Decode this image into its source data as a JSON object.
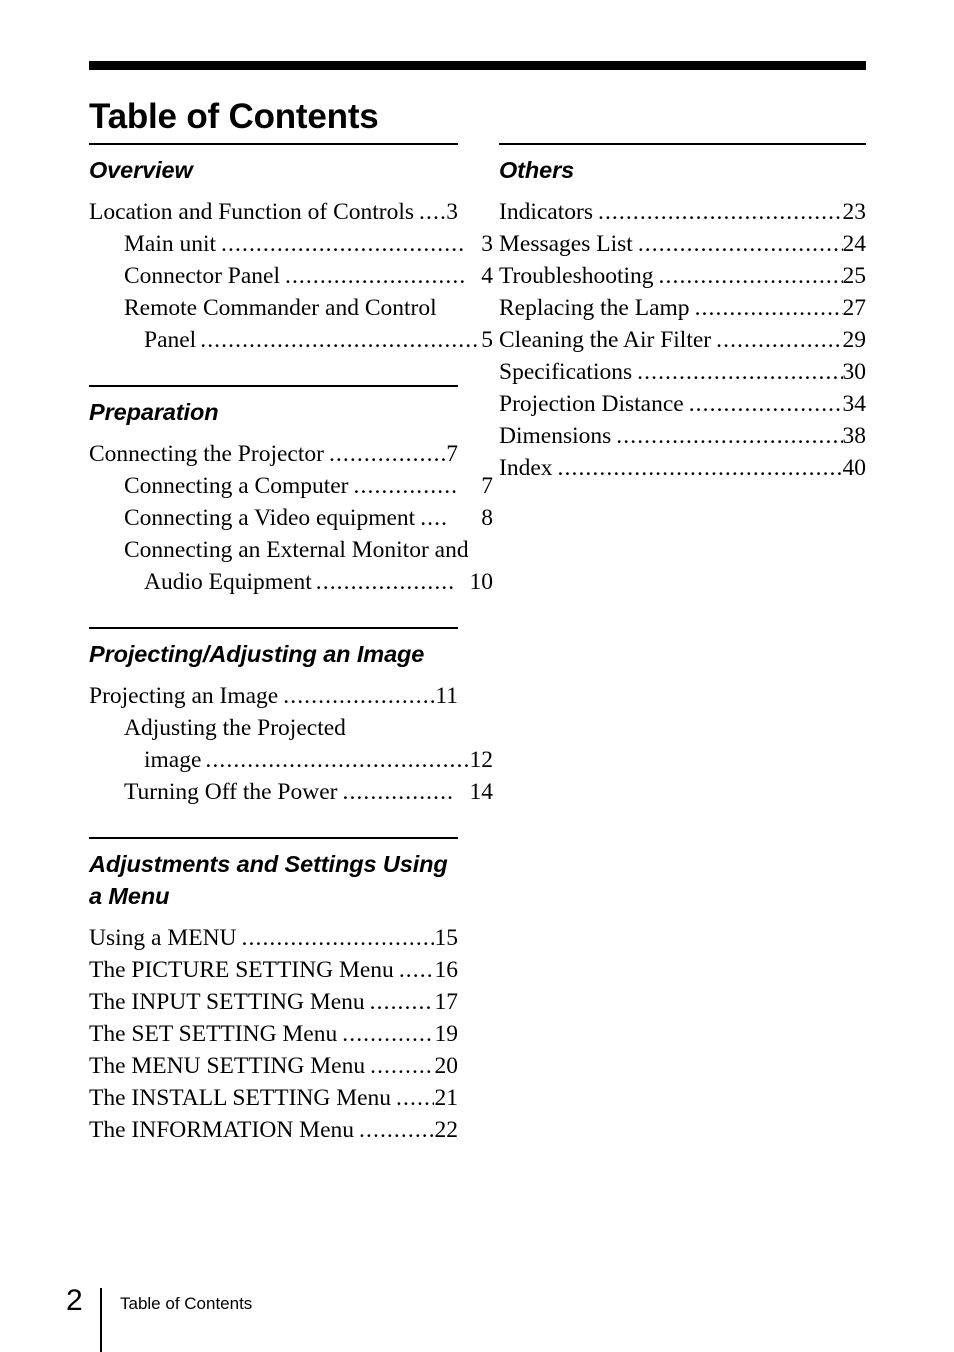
{
  "document": {
    "title": "Table of Contents",
    "page_number": "2",
    "footer_label": "Table of Contents"
  },
  "columns": {
    "left": [
      {
        "heading": "Overview",
        "entries": [
          {
            "level": 1,
            "label": "Location and Function of Controls",
            "page": "3",
            "leader": "...."
          },
          {
            "level": 2,
            "label": "Main unit",
            "page": "3",
            "leader": "..................................."
          },
          {
            "level": 2,
            "label": "Connector Panel",
            "page": "4",
            "leader": ".........................."
          },
          {
            "level": 2,
            "wrapped": true,
            "line1": "Remote Commander and Control",
            "line2": "Panel",
            "page": "5",
            "leader": "........................................."
          }
        ]
      },
      {
        "heading": "Preparation",
        "entries": [
          {
            "level": 1,
            "label": "Connecting the Projector",
            "page": "7",
            "leader": ".................."
          },
          {
            "level": 2,
            "label": "Connecting a Computer",
            "page": "7",
            "leader": "..............."
          },
          {
            "level": 2,
            "label": "Connecting a Video equipment",
            "page": "8",
            "leader": "...."
          },
          {
            "level": 2,
            "wrapped": true,
            "line1": "Connecting an External Monitor and",
            "line2": "Audio Equipment",
            "page": "10",
            "leader": "...................."
          }
        ]
      },
      {
        "heading": "Projecting/Adjusting an Image",
        "entries": [
          {
            "level": 1,
            "label": "Projecting an Image",
            "page": "11",
            "leader": "........................"
          },
          {
            "level": 2,
            "wrapped": true,
            "line1": "Adjusting the Projected",
            "line2": "image",
            "page": "12",
            "leader": "......................................"
          },
          {
            "level": 2,
            "label": "Turning Off the Power",
            "page": "14",
            "leader": "................"
          }
        ]
      },
      {
        "heading": "Adjustments and Settings Using a Menu",
        "entries": [
          {
            "level": 1,
            "label": "Using a MENU",
            "page": "15",
            "leader": "................................."
          },
          {
            "level": 1,
            "label": "The PICTURE SETTING Menu",
            "page": "16",
            "leader": "......"
          },
          {
            "level": 1,
            "label": "The INPUT SETTING Menu",
            "page": "17",
            "leader": ".........."
          },
          {
            "level": 1,
            "label": "The SET SETTING Menu",
            "page": "19",
            "leader": "..............."
          },
          {
            "level": 1,
            "label": "The MENU SETTING Menu",
            "page": "20",
            "leader": ".........."
          },
          {
            "level": 1,
            "label": "The INSTALL SETTING Menu",
            "page": "21",
            "leader": "......"
          },
          {
            "level": 1,
            "label": "The INFORMATION Menu",
            "page": "22",
            "leader": "............"
          }
        ]
      }
    ],
    "right": [
      {
        "heading": "Others",
        "entries": [
          {
            "level": 1,
            "label": "Indicators",
            "page": "23",
            "leader": "........................................."
          },
          {
            "level": 1,
            "label": "Messages List",
            "page": "24",
            "leader": "................................."
          },
          {
            "level": 1,
            "label": "Troubleshooting",
            "page": "25",
            "leader": "..............................."
          },
          {
            "level": 1,
            "label": "Replacing the Lamp",
            "page": "27",
            "leader": ".........................."
          },
          {
            "level": 1,
            "label": "Cleaning the Air Filter",
            "page": "29",
            "leader": "......................"
          },
          {
            "level": 1,
            "label": "Specifications",
            "page": "30",
            "leader": "..................................."
          },
          {
            "level": 1,
            "label": "Projection Distance",
            "page": "34",
            "leader": ".........................."
          },
          {
            "level": 1,
            "label": "Dimensions",
            "page": "38",
            "leader": "......................................"
          },
          {
            "level": 1,
            "label": "Index",
            "page": "40",
            "leader": "................................................"
          }
        ]
      }
    ]
  }
}
